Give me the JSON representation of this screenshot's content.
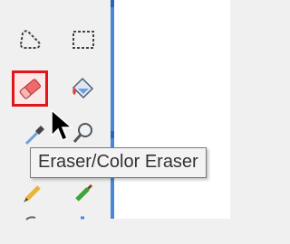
{
  "toolbox": {
    "tools": [
      {
        "name": "free-form-select",
        "icon": "lasso-select-icon"
      },
      {
        "name": "rectangle-select",
        "icon": "rectangle-select-icon"
      },
      {
        "name": "eraser",
        "icon": "eraser-icon",
        "selected": true
      },
      {
        "name": "fill",
        "icon": "paint-bucket-icon"
      },
      {
        "name": "color-picker",
        "icon": "eyedropper-icon"
      },
      {
        "name": "magnifier",
        "icon": "magnifier-icon"
      },
      {
        "name": "pencil",
        "icon": "pencil-icon"
      },
      {
        "name": "brush",
        "icon": "brush-icon"
      }
    ]
  },
  "tooltip": {
    "text": "Eraser/Color Eraser"
  },
  "colors": {
    "selection_border": "#e0161b",
    "canvas_edge": "#4a87d6"
  }
}
